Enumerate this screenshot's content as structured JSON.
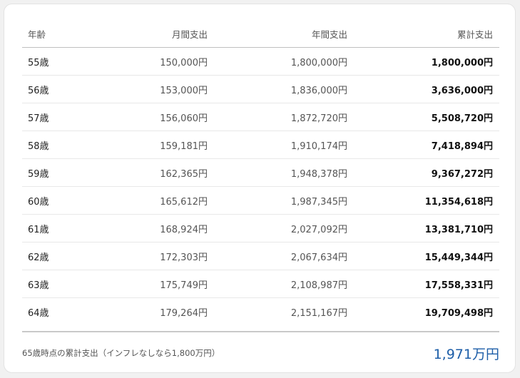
{
  "table": {
    "headers": {
      "age": "年齢",
      "monthly": "月間支出",
      "annual": "年間支出",
      "cumulative": "累計支出"
    },
    "rows": [
      {
        "age": "55歳",
        "monthly": "150,000円",
        "annual": "1,800,000円",
        "cumulative": "1,800,000円"
      },
      {
        "age": "56歳",
        "monthly": "153,000円",
        "annual": "1,836,000円",
        "cumulative": "3,636,000円"
      },
      {
        "age": "57歳",
        "monthly": "156,060円",
        "annual": "1,872,720円",
        "cumulative": "5,508,720円"
      },
      {
        "age": "58歳",
        "monthly": "159,181円",
        "annual": "1,910,174円",
        "cumulative": "7,418,894円"
      },
      {
        "age": "59歳",
        "monthly": "162,365円",
        "annual": "1,948,378円",
        "cumulative": "9,367,272円"
      },
      {
        "age": "60歳",
        "monthly": "165,612円",
        "annual": "1,987,345円",
        "cumulative": "11,354,618円"
      },
      {
        "age": "61歳",
        "monthly": "168,924円",
        "annual": "2,027,092円",
        "cumulative": "13,381,710円"
      },
      {
        "age": "62歳",
        "monthly": "172,303円",
        "annual": "2,067,634円",
        "cumulative": "15,449,344円"
      },
      {
        "age": "63歳",
        "monthly": "175,749円",
        "annual": "2,108,987円",
        "cumulative": "17,558,331円"
      },
      {
        "age": "64歳",
        "monthly": "179,264円",
        "annual": "2,151,167円",
        "cumulative": "19,709,498円"
      }
    ]
  },
  "footer": {
    "label": "65歳時点の累計支出（インフレなしなら1,800万円）",
    "value": "1,971万円"
  },
  "colors": {
    "accent": "#1d5ea8"
  }
}
